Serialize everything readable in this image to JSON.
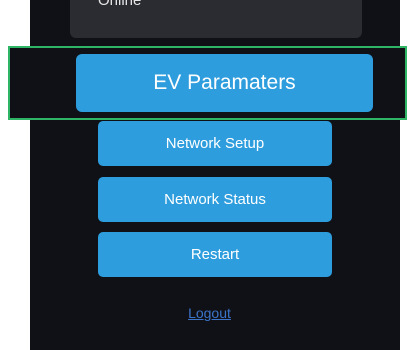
{
  "status_card": {
    "text": "Online"
  },
  "buttons": {
    "ev_parameters": "EV Paramaters",
    "network_setup": "Network Setup",
    "network_status": "Network Status",
    "restart": "Restart"
  },
  "links": {
    "logout": "Logout"
  },
  "colors": {
    "background": "#101117",
    "button": "#2e9ddd",
    "highlight_border": "#2fb566",
    "link": "#3b74c9"
  }
}
